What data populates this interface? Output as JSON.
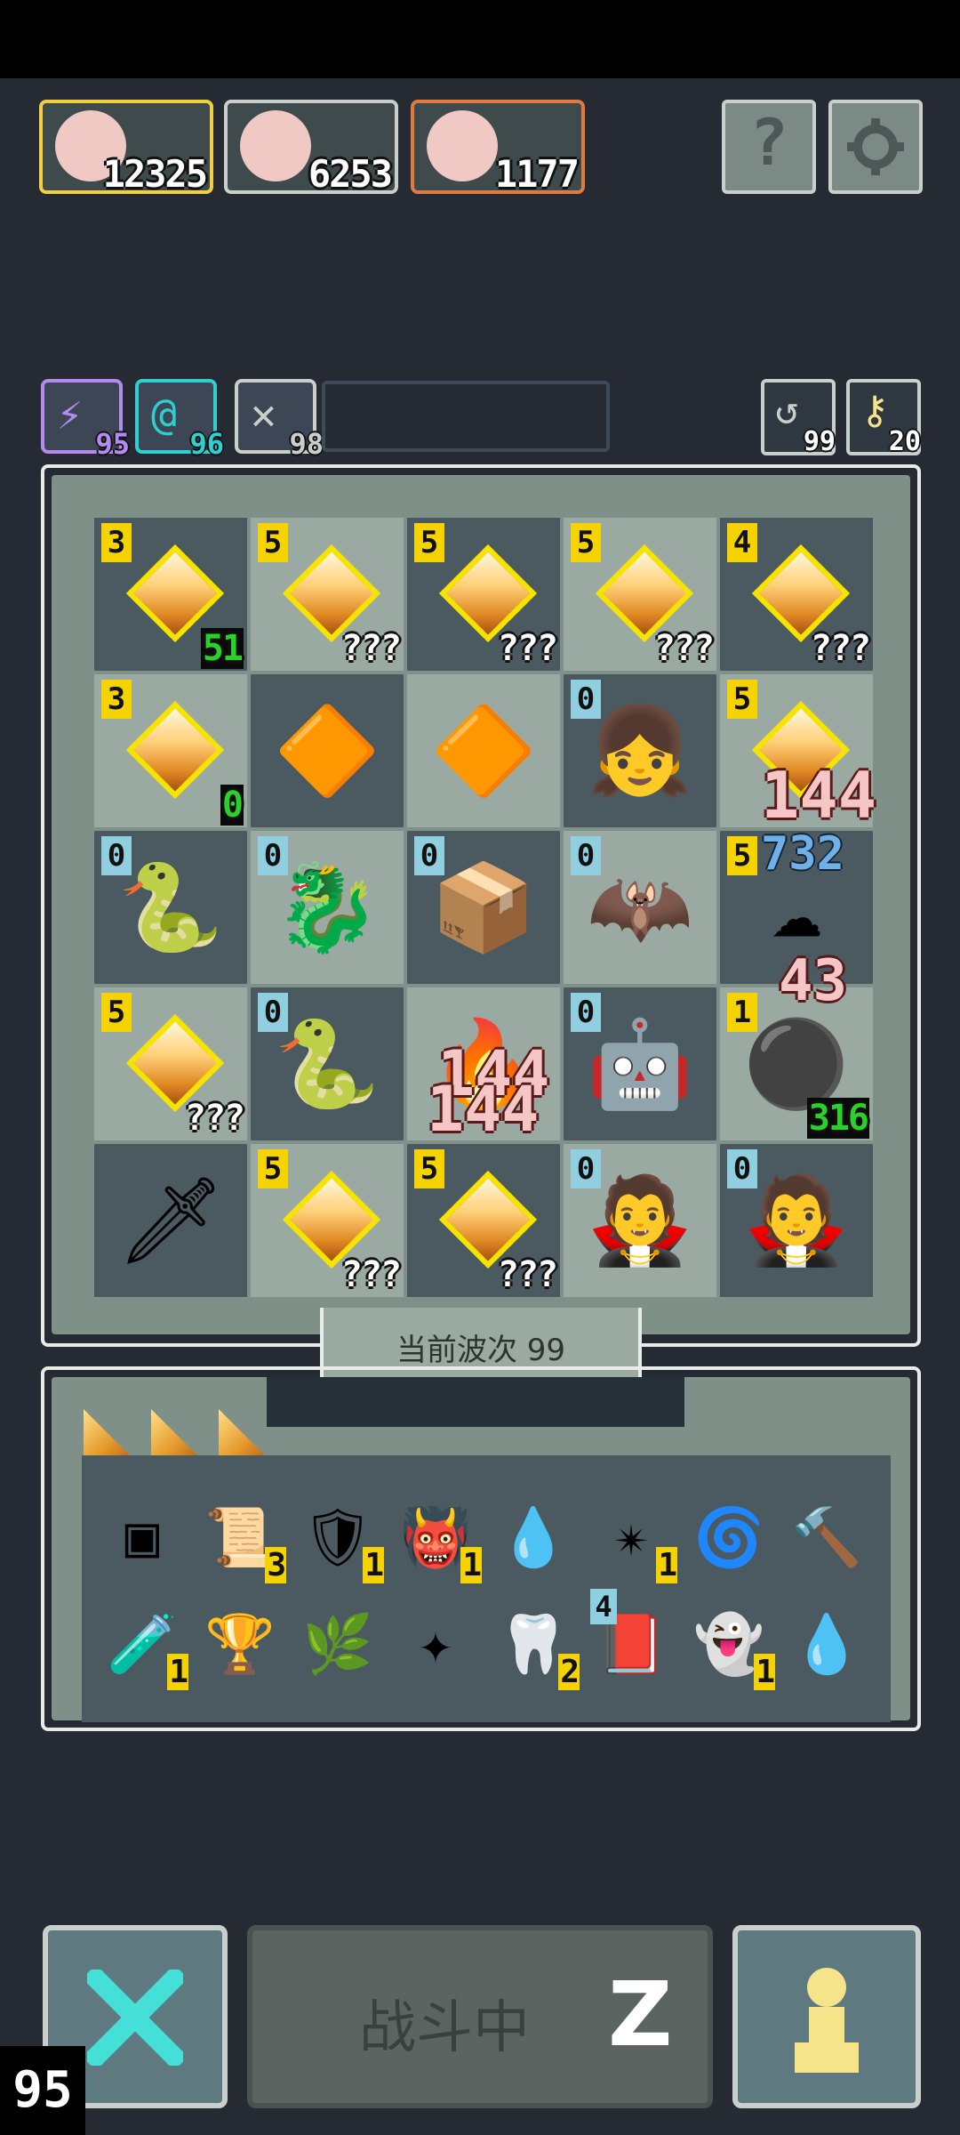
{
  "party": [
    {
      "name": "hero-1",
      "value": "12325",
      "border": "#f0d040"
    },
    {
      "name": "hero-2",
      "value": "6253",
      "border": "#c9d0cc"
    },
    {
      "name": "hero-3",
      "value": "1177",
      "border": "#e07a40"
    }
  ],
  "top_buttons": {
    "help_symbol": "?",
    "settings_icon": "gear-icon"
  },
  "skills": [
    {
      "icon": "lightning-icon",
      "value": "95",
      "color": "#b48cf0"
    },
    {
      "icon": "swirl-icon",
      "value": "96",
      "color": "#2ecfcf"
    },
    {
      "icon": "wing-icon",
      "value": "98",
      "color": "#c9d0cc"
    }
  ],
  "resources": [
    {
      "icon": "refresh-icon",
      "value": "99"
    },
    {
      "icon": "key-icon",
      "value": "20"
    }
  ],
  "board": {
    "cells": [
      {
        "level": "3",
        "lvlcolor": "y",
        "type": "gem",
        "count": "51",
        "green": true
      },
      {
        "level": "5",
        "lvlcolor": "y",
        "type": "gem",
        "count": "???"
      },
      {
        "level": "5",
        "lvlcolor": "y",
        "type": "gem",
        "count": "???"
      },
      {
        "level": "5",
        "lvlcolor": "y",
        "type": "gem",
        "count": "???"
      },
      {
        "level": "4",
        "lvlcolor": "y",
        "type": "gem",
        "count": "???"
      },
      {
        "level": "3",
        "lvlcolor": "y",
        "type": "gem",
        "count": "0",
        "green": true
      },
      {
        "level": "",
        "type": "sprite",
        "glyph": "🔶"
      },
      {
        "level": "",
        "type": "sprite",
        "glyph": "🔶"
      },
      {
        "level": "0",
        "lvlcolor": "b",
        "type": "sprite",
        "glyph": "👧"
      },
      {
        "level": "5",
        "lvlcolor": "y",
        "type": "gem",
        "count": ""
      },
      {
        "level": "0",
        "lvlcolor": "b",
        "type": "sprite",
        "glyph": "🐍"
      },
      {
        "level": "0",
        "lvlcolor": "b",
        "type": "sprite",
        "glyph": "🐉"
      },
      {
        "level": "0",
        "lvlcolor": "b",
        "type": "sprite",
        "glyph": "📦"
      },
      {
        "level": "0",
        "lvlcolor": "b",
        "type": "sprite",
        "glyph": "🦇"
      },
      {
        "level": "5",
        "lvlcolor": "y",
        "type": "sprite",
        "glyph": "☁"
      },
      {
        "level": "5",
        "lvlcolor": "y",
        "type": "gem",
        "count": "???"
      },
      {
        "level": "0",
        "lvlcolor": "b",
        "type": "sprite",
        "glyph": "🐍"
      },
      {
        "level": "",
        "type": "sprite",
        "glyph": "🔥"
      },
      {
        "level": "0",
        "lvlcolor": "b",
        "type": "sprite",
        "glyph": "🤖"
      },
      {
        "level": "1",
        "lvlcolor": "y",
        "type": "sprite",
        "glyph": "⚫",
        "count": "316",
        "green": true
      },
      {
        "level": "",
        "type": "sprite",
        "glyph": "🗡"
      },
      {
        "level": "5",
        "lvlcolor": "y",
        "type": "gem",
        "count": "???"
      },
      {
        "level": "5",
        "lvlcolor": "y",
        "type": "gem",
        "count": "???"
      },
      {
        "level": "0",
        "lvlcolor": "b",
        "type": "sprite",
        "glyph": "🧛"
      },
      {
        "level": "0",
        "lvlcolor": "b",
        "type": "sprite",
        "glyph": "🧛"
      }
    ],
    "damage_texts": [
      "144",
      "732",
      "43",
      "144",
      "144"
    ]
  },
  "wave_label": "当前波次 99",
  "shards_count": 3,
  "items": [
    {
      "icon": "crate-icon",
      "glyph": "▣",
      "count": ""
    },
    {
      "icon": "scroll-icon",
      "glyph": "📜",
      "count": "3"
    },
    {
      "icon": "heart-shield-icon",
      "glyph": "🛡",
      "count": "1"
    },
    {
      "icon": "demon-mask-icon",
      "glyph": "👹",
      "count": "1"
    },
    {
      "icon": "water-drop-box-icon",
      "glyph": "💧",
      "count": ""
    },
    {
      "icon": "star-burst-icon",
      "glyph": "✴",
      "count": "1"
    },
    {
      "icon": "tornado-icon",
      "glyph": "🌀",
      "count": ""
    },
    {
      "icon": "hammer-icon",
      "glyph": "🔨",
      "count": ""
    },
    {
      "icon": "potion-jar-icon",
      "glyph": "🧪",
      "count": "1"
    },
    {
      "icon": "goblet-icon",
      "glyph": "🏆",
      "count": ""
    },
    {
      "icon": "thorn-bush-icon",
      "glyph": "🌿",
      "count": ""
    },
    {
      "icon": "shuriken-icon",
      "glyph": "✦",
      "count": ""
    },
    {
      "icon": "teeth-icon",
      "glyph": "🦷",
      "count": "2"
    },
    {
      "icon": "fire-scroll-icon",
      "glyph": "📕",
      "count": ""
    },
    {
      "icon": "skull-ghost-icon",
      "glyph": "👻",
      "count": "1"
    },
    {
      "icon": "blue-drop-icon",
      "glyph": "💧",
      "count": ""
    }
  ],
  "fire_scroll_level": "4",
  "bottom": {
    "fight_label": "战斗中",
    "sleep_symbol": "Z",
    "corner_counter": "95"
  }
}
